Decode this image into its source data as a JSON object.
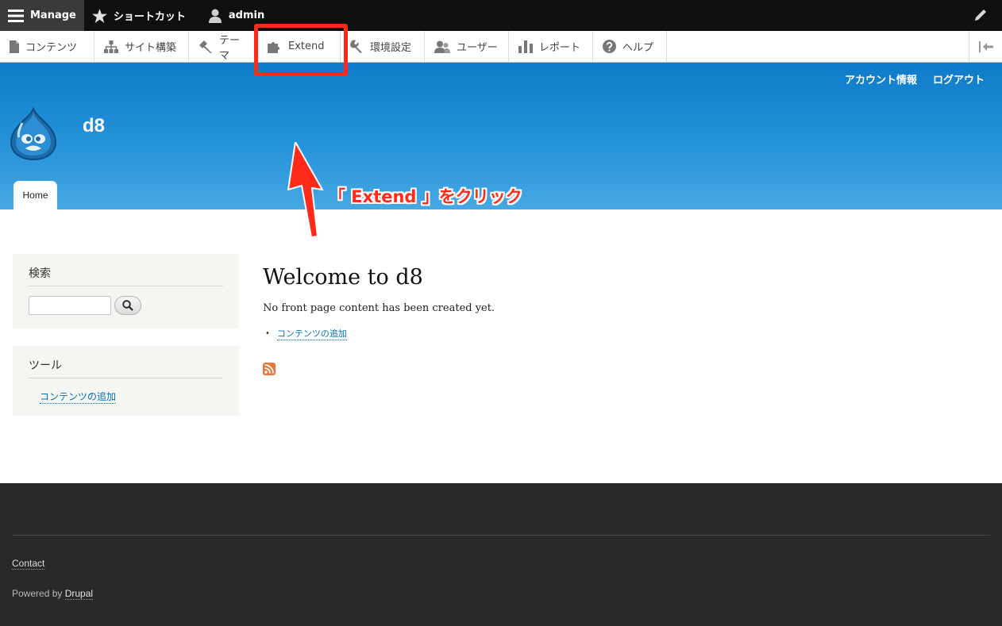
{
  "toolbar": {
    "manage_label": "Manage",
    "shortcuts_label": "ショートカット",
    "user_label": "admin"
  },
  "tray": {
    "items": [
      {
        "label": "コンテンツ",
        "icon": "file-icon"
      },
      {
        "label": "サイト構築",
        "icon": "sitemap-icon"
      },
      {
        "label": "テーマ",
        "icon": "paint-icon"
      },
      {
        "label": "Extend",
        "icon": "puzzle-icon"
      },
      {
        "label": "環境設定",
        "icon": "wrench-icon"
      },
      {
        "label": "ユーザー",
        "icon": "people-icon"
      },
      {
        "label": "レポート",
        "icon": "bar-chart-icon"
      },
      {
        "label": "ヘルプ",
        "icon": "question-icon"
      }
    ]
  },
  "header": {
    "account_link": "アカウント情報",
    "logout_link": "ログアウト",
    "site_name": "d8",
    "home_tab": "Home"
  },
  "annotation": {
    "text": "「 Extend 」をクリック",
    "color": "#ff2a1a"
  },
  "sidebar": {
    "search_title": "検索",
    "tools_title": "ツール",
    "tools_link": "コンテンツの追加"
  },
  "main": {
    "title": "Welcome to d8",
    "intro": "No front page content has been created yet.",
    "add_content_link": "コンテンツの追加"
  },
  "footer": {
    "contact": "Contact",
    "powered_by": "Powered by",
    "drupal": "Drupal"
  },
  "colors": {
    "header_blue": "#1a87d3",
    "link": "#0071b3",
    "footer_bg": "#292929"
  }
}
